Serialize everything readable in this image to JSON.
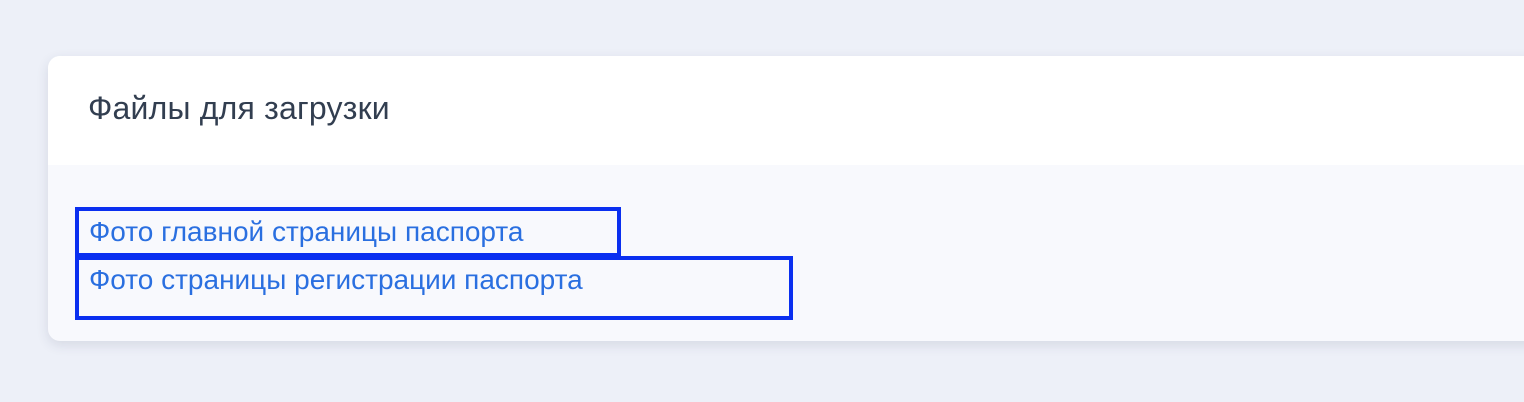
{
  "section": {
    "title": "Файлы для загрузки"
  },
  "files": [
    {
      "label": "Фото главной страницы паспорта"
    },
    {
      "label": "Фото страницы регистрации паспорта"
    }
  ],
  "colors": {
    "page_background": "#edf0f8",
    "header_background": "#ffffff",
    "body_background": "#f8f9fd",
    "title_text": "#323e50",
    "link_text": "#2a6fe0",
    "highlight_border": "#0a2ff0"
  }
}
